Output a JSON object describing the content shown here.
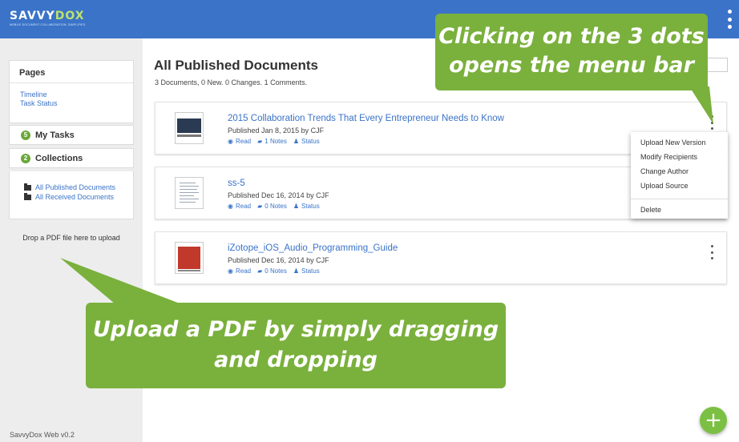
{
  "header": {
    "logo_main": "SAVVY",
    "logo_accent": "DOX",
    "logo_tagline": "MOBILE DOCUMENT COLLABORATION, SIMPLIFIED",
    "menu_icon": "vertical-dots-icon"
  },
  "sidebar": {
    "pages_title": "Pages",
    "pages_links": [
      "Timeline",
      "Task Status"
    ],
    "my_tasks": {
      "count": "5",
      "label": "My Tasks"
    },
    "collections": {
      "count": "2",
      "label": "Collections"
    },
    "collection_links": [
      "All Published Documents",
      "All Received Documents"
    ],
    "drop_text": "Drop a PDF file here to upload",
    "version": "SavvyDox Web v0.2"
  },
  "main": {
    "title": "All Published Documents",
    "subtitle": "3 Documents, 0 New. 0 Changes. 1 Comments."
  },
  "documents": [
    {
      "title": "2015 Collaboration Trends That Every Entrepreneur Needs to Know",
      "meta": "Published Jan 8, 2015 by CJF",
      "read": "Read",
      "notes": "1 Notes",
      "status": "Status"
    },
    {
      "title": "ss-5",
      "meta": "Published Dec 16, 2014 by CJF",
      "read": "Read",
      "notes": "0 Notes",
      "status": "Status"
    },
    {
      "title": "iZotope_iOS_Audio_Programming_Guide",
      "meta": "Published Dec 16, 2014 by CJF",
      "read": "Read",
      "notes": "0 Notes",
      "status": "Status"
    }
  ],
  "context_menu": {
    "items": [
      "Upload New Version",
      "Modify Recipients",
      "Change Author",
      "Upload Source"
    ],
    "danger_item": "Delete"
  },
  "fab": {
    "label": "+",
    "color": "#7bc043"
  },
  "callouts": {
    "top_line1": "Clicking on the 3 dots",
    "top_line2": "opens the menu bar",
    "bottom_line1": "Upload a PDF by simply dragging",
    "bottom_line2": "and dropping",
    "color": "#7ab03c"
  },
  "colors": {
    "header_blue": "#3a73c8",
    "link_blue": "#3a73c8",
    "badge_green": "#6aa83a"
  }
}
